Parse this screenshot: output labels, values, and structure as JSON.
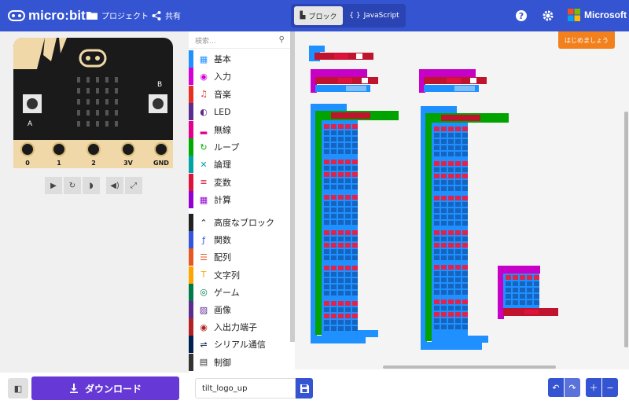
{
  "header": {
    "logo_text": "micro:bit",
    "projects_label": "プロジェクト",
    "share_label": "共有",
    "mode_blocks_label": "ブロック",
    "mode_js_label": "JavaScript",
    "brand_label": "Microsoft"
  },
  "toolbox": {
    "search_placeholder": "検索...",
    "categories": [
      {
        "label": "基本",
        "color": "#1e90ff"
      },
      {
        "label": "入力",
        "color": "#d400d4"
      },
      {
        "label": "音楽",
        "color": "#e63022"
      },
      {
        "label": "LED",
        "color": "#5c2d91"
      },
      {
        "label": "無線",
        "color": "#e3008c"
      },
      {
        "label": "ループ",
        "color": "#00aa00"
      },
      {
        "label": "論理",
        "color": "#00a4a6"
      },
      {
        "label": "変数",
        "color": "#dc143c"
      },
      {
        "label": "計算",
        "color": "#9400d3"
      },
      {
        "label": "高度なブロック",
        "color": "#222222"
      },
      {
        "label": "関数",
        "color": "#3455db"
      },
      {
        "label": "配列",
        "color": "#e65722"
      },
      {
        "label": "文字列",
        "color": "#ffa500"
      },
      {
        "label": "ゲーム",
        "color": "#007a4b"
      },
      {
        "label": "画像",
        "color": "#5c2d91"
      },
      {
        "label": "入出力端子",
        "color": "#b22222"
      },
      {
        "label": "シリアル通信",
        "color": "#002050"
      },
      {
        "label": "制御",
        "color": "#333333"
      }
    ]
  },
  "simulator": {
    "pins": [
      "0",
      "1",
      "2",
      "3V",
      "GND"
    ],
    "button_a": "A",
    "button_b": "B"
  },
  "workspace": {
    "start_tutorial_label": "はじめましょう"
  },
  "footer": {
    "download_label": "ダウンロード",
    "project_name": "tilt_logo_up"
  },
  "colors": {
    "header": "#3454d1",
    "download": "#6638d6",
    "tutorial": "#f2811d",
    "block_blue": "#1e90ff",
    "block_red": "#c0132e",
    "block_green": "#00a300",
    "block_magenta": "#c700c7"
  }
}
